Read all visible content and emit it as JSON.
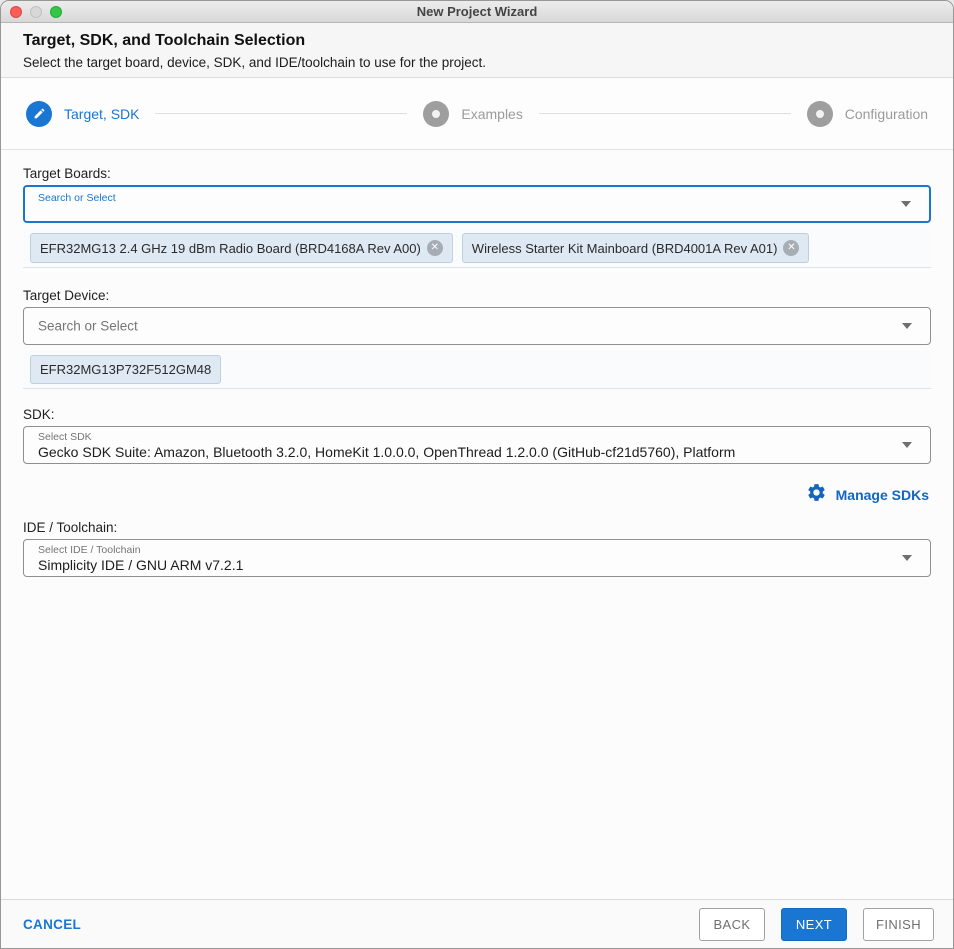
{
  "window": {
    "title": "New Project Wizard"
  },
  "header": {
    "title": "Target, SDK, and Toolchain Selection",
    "subtitle": "Select the target board, device, SDK, and IDE/toolchain to use for the project."
  },
  "stepper": {
    "steps": [
      {
        "label": "Target, SDK",
        "state": "active",
        "icon": "pencil-icon"
      },
      {
        "label": "Examples",
        "state": "pending",
        "icon": "dot-icon"
      },
      {
        "label": "Configuration",
        "state": "pending",
        "icon": "dot-icon"
      }
    ]
  },
  "sections": {
    "target_boards": {
      "label": "Target Boards:",
      "placeholder": "Search or Select",
      "chips": [
        {
          "label": "EFR32MG13 2.4 GHz 19 dBm Radio Board (BRD4168A Rev A00)",
          "removable": true
        },
        {
          "label": "Wireless Starter Kit Mainboard (BRD4001A Rev A01)",
          "removable": true
        }
      ]
    },
    "target_device": {
      "label": "Target Device:",
      "placeholder": "Search or Select",
      "chips": [
        {
          "label": "EFR32MG13P732F512GM48",
          "removable": false
        }
      ]
    },
    "sdk": {
      "label": "SDK:",
      "field_label": "Select SDK",
      "value": "Gecko SDK Suite: Amazon, Bluetooth 3.2.0, HomeKit 1.0.0.0, OpenThread 1.2.0.0 (GitHub-cf21d5760), Platform",
      "manage_label": "Manage SDKs"
    },
    "ide": {
      "label": "IDE / Toolchain:",
      "field_label": "Select IDE / Toolchain",
      "value": "Simplicity IDE / GNU ARM v7.2.1"
    }
  },
  "footer": {
    "cancel_label": "CANCEL",
    "back_label": "BACK",
    "next_label": "NEXT",
    "finish_label": "FINISH"
  },
  "icons": {
    "chip_remove_glyph": "✕",
    "step_active": "pencil-icon",
    "step_pending": "dot-icon",
    "combo_arrow": "chevron-down-icon",
    "manage": "gear-icon"
  },
  "colors": {
    "accent": "#1976d2",
    "manage_blue": "#1565c0",
    "chip_bg": "#dee9f4",
    "step_inactive": "#9e9e9e",
    "traffic_red": "#fc5b57",
    "traffic_gray": "#d8d8d8",
    "traffic_green": "#33c748"
  }
}
